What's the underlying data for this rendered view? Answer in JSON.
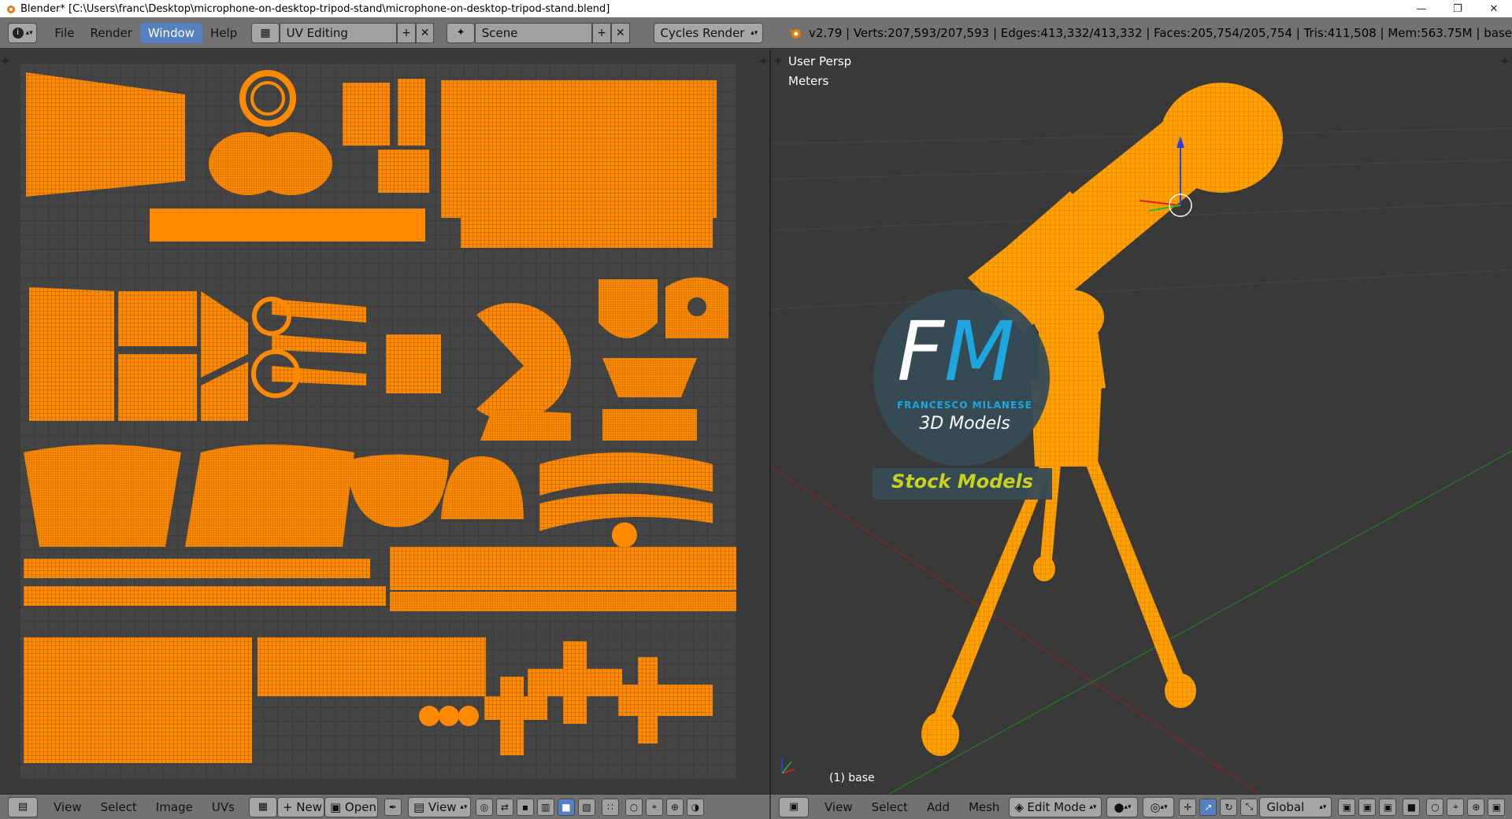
{
  "titlebar": {
    "title": "Blender* [C:\\Users\\franc\\Desktop\\microphone-on-desktop-tripod-stand\\microphone-on-desktop-tripod-stand.blend]",
    "minimize": "—",
    "restore": "❐",
    "close": "✕"
  },
  "infobar": {
    "menus": [
      "File",
      "Render",
      "Window",
      "Help"
    ],
    "active_menu": "Window",
    "layout": "UV Editing",
    "scene": "Scene",
    "engine": "Cycles Render",
    "stats": "v2.79 | Verts:207,593/207,593 | Edges:413,332/413,332 | Faces:205,754/205,754 | Tris:411,508 | Mem:563.75M | base"
  },
  "viewport": {
    "view_name": "User Persp",
    "units": "Meters",
    "object_label": "(1) base"
  },
  "logo": {
    "letters_f": "F",
    "letters_m": "M",
    "name": "FRANCESCO MILANESE",
    "sub": "3D Models",
    "banner": "Stock Models"
  },
  "uv_footer": {
    "menus": [
      "View",
      "Select",
      "Image",
      "UVs"
    ],
    "new_label": "New",
    "open_label": "Open",
    "view_label": "View"
  },
  "view3d_footer": {
    "menus": [
      "View",
      "Select",
      "Add",
      "Mesh"
    ],
    "mode": "Edit Mode",
    "orientation": "Global"
  },
  "colors": {
    "mesh_orange": "#ff8a00",
    "accent_blue": "#5680c2",
    "logo_cyan": "#1ea6e0",
    "banner_yellow": "#c8d21e"
  }
}
